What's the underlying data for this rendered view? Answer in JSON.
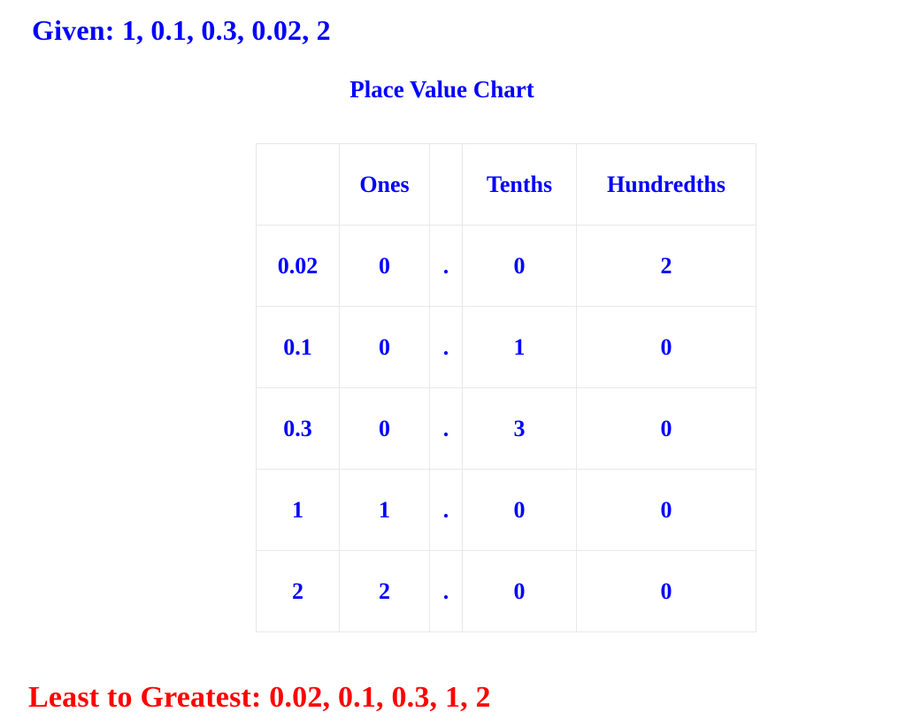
{
  "colors": {
    "primary_text": "#0000ff",
    "answer_text": "#ff0000",
    "table_border": "#e8e8e8",
    "background": "#ffffff"
  },
  "given": {
    "label": "Given: 1, 0.1, 0.3, 0.02, 2",
    "numbers": [
      1,
      0.1,
      0.3,
      0.02,
      2
    ]
  },
  "chart": {
    "title": "Place Value Chart",
    "headers": [
      "",
      "Ones",
      "",
      "Tenths",
      "Hundredths"
    ],
    "decimal_separator": ".",
    "rows": [
      {
        "label": "0.02",
        "ones": "0",
        "dot": ".",
        "tenths": "0",
        "hundredths": "2"
      },
      {
        "label": "0.1",
        "ones": "0",
        "dot": ".",
        "tenths": "1",
        "hundredths": "0"
      },
      {
        "label": "0.3",
        "ones": "0",
        "dot": ".",
        "tenths": "3",
        "hundredths": "0"
      },
      {
        "label": "1",
        "ones": "1",
        "dot": ".",
        "tenths": "0",
        "hundredths": "0"
      },
      {
        "label": "2",
        "ones": "2",
        "dot": ".",
        "tenths": "0",
        "hundredths": "0"
      }
    ]
  },
  "answer": {
    "label": "Least to Greatest: 0.02, 0.1, 0.3, 1, 2",
    "ordered_numbers": [
      0.02,
      0.1,
      0.3,
      1,
      2
    ]
  }
}
